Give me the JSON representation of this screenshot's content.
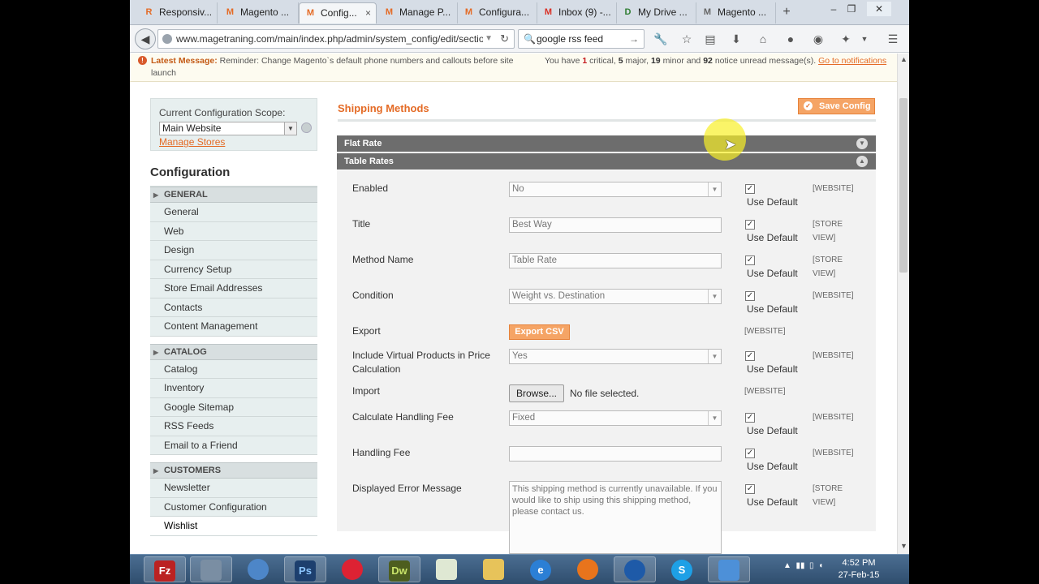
{
  "browser": {
    "tabs": [
      {
        "label": "Responsiv...",
        "icon": "R",
        "active": false
      },
      {
        "label": "Magento ...",
        "icon": "M",
        "active": false
      },
      {
        "label": "Config...",
        "icon": "M",
        "active": true
      },
      {
        "label": "Manage P...",
        "icon": "M",
        "active": false
      },
      {
        "label": "Configura...",
        "icon": "M",
        "active": false
      },
      {
        "label": "Inbox (9) -...",
        "icon": "M",
        "active": false
      },
      {
        "label": "My Drive ...",
        "icon": "D",
        "active": false
      },
      {
        "label": "Magento ...",
        "icon": "M",
        "active": false
      }
    ],
    "tab_close": "×",
    "new_tab": "+",
    "url": "www.magetraning.com/main/index.php/admin/system_config/edit/section",
    "search_value": "google rss feed"
  },
  "notice": {
    "latest_label": "Latest Message:",
    "latest_text": "Reminder: Change Magento`s default phone numbers and callouts before site launch",
    "summary_prefix": "You have",
    "critical_count": "1",
    "critical_label": "critical,",
    "major_count": "5",
    "major_label": "major,",
    "minor_count": "19",
    "minor_label": "minor and",
    "notice_count": "92",
    "notice_label": "notice unread message(s).",
    "link": "Go to notifications"
  },
  "scope": {
    "label": "Current Configuration Scope:",
    "value": "Main Website",
    "manage_stores": "Manage Stores"
  },
  "sidebar": {
    "title": "Configuration",
    "sections": [
      {
        "label": "GENERAL",
        "items": [
          "General",
          "Web",
          "Design",
          "Currency Setup",
          "Store Email Addresses",
          "Contacts",
          "Content Management"
        ]
      },
      {
        "label": "CATALOG",
        "items": [
          "Catalog",
          "Inventory",
          "Google Sitemap",
          "RSS Feeds",
          "Email to a Friend"
        ]
      },
      {
        "label": "CUSTOMERS",
        "items": [
          "Newsletter",
          "Customer Configuration",
          "Wishlist"
        ]
      }
    ]
  },
  "main": {
    "title": "Shipping Methods",
    "save_button": "Save Config",
    "sections": [
      {
        "label": "Flat Rate",
        "state": "collapsed"
      },
      {
        "label": "Table Rates",
        "state": "expanded"
      }
    ],
    "fields": [
      {
        "label": "Enabled",
        "type": "select",
        "value": "No",
        "use_default": "Use Default",
        "scope": "[WEBSITE]"
      },
      {
        "label": "Title",
        "type": "text",
        "value": "Best Way",
        "use_default": "Use Default",
        "scope": "[STORE VIEW]"
      },
      {
        "label": "Method Name",
        "type": "text",
        "value": "Table Rate",
        "use_default": "Use Default",
        "scope": "[STORE VIEW]"
      },
      {
        "label": "Condition",
        "type": "select",
        "value": "Weight vs. Destination",
        "use_default": "Use Default",
        "scope": "[WEBSITE]"
      },
      {
        "label": "Export",
        "type": "button",
        "value": "Export CSV",
        "scope": "[WEBSITE]"
      },
      {
        "label": "Include Virtual Products in Price Calculation",
        "type": "select",
        "value": "Yes",
        "use_default": "Use Default",
        "scope": "[WEBSITE]"
      },
      {
        "label": "Import",
        "type": "file",
        "button": "Browse...",
        "value": "No file selected.",
        "scope": "[WEBSITE]"
      },
      {
        "label": "Calculate Handling Fee",
        "type": "select",
        "value": "Fixed",
        "use_default": "Use Default",
        "scope": "[WEBSITE]"
      },
      {
        "label": "Handling Fee",
        "type": "text",
        "value": "",
        "use_default": "Use Default",
        "scope": "[WEBSITE]"
      },
      {
        "label": "Displayed Error Message",
        "type": "textarea",
        "value": "This shipping method is currently unavailable. If you would like to ship using this shipping method, please contact us.",
        "use_default": "Use Default",
        "scope": "[STORE VIEW]"
      }
    ]
  },
  "taskbar": {
    "apps": [
      "Fz",
      "",
      "",
      "Ps",
      "",
      "Dw",
      "",
      "",
      "e",
      "",
      "",
      "S",
      ""
    ],
    "time": "4:52 PM",
    "date": "27-Feb-15"
  },
  "colors": {
    "accent": "#e46b26",
    "section_header": "#6d6d6d",
    "nav_bg": "#e7efef"
  }
}
